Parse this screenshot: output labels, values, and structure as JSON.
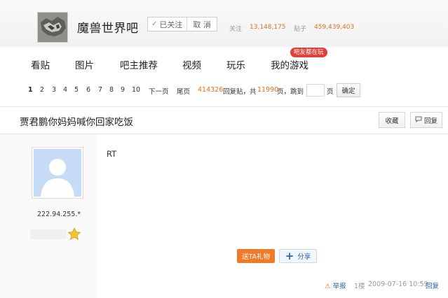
{
  "forum": {
    "title": "魔兽世界吧",
    "followed_label": "已关注",
    "unfollow_label": "取 消",
    "follow_count_label": "关注",
    "follow_count": "13,148,175",
    "post_count_label": "贴子",
    "post_count": "459,439,403"
  },
  "nav": {
    "items": [
      {
        "label": "看贴"
      },
      {
        "label": "图片"
      },
      {
        "label": "吧主推荐"
      },
      {
        "label": "视频"
      },
      {
        "label": "玩乐"
      },
      {
        "label": "我的游戏"
      }
    ],
    "bubble": "吧友都在玩"
  },
  "pager": {
    "pages": [
      "1",
      "2",
      "3",
      "4",
      "5",
      "6",
      "7",
      "8",
      "9",
      "10"
    ],
    "current": "1",
    "next": "下一页",
    "last": "尾页",
    "reply_total": "414326",
    "reply_label": "回复贴，共",
    "page_total": "11990",
    "page_label": "页，",
    "jump_label": "跳到",
    "jump_value": "",
    "page_unit": "页",
    "confirm": "确定"
  },
  "thread": {
    "title": "贾君鹏你妈妈喊你回家吃饭",
    "favorite": "收藏",
    "reply": "回复"
  },
  "post": {
    "author_ip": "222.94.255.*",
    "content": "RT",
    "gift": "送TA礼物",
    "share": "分享",
    "report": "举报",
    "floor": "1楼",
    "time": "2009-07-16 10:59",
    "reply": "回复"
  },
  "colors": {
    "accent_orange": "#e0701e",
    "link_blue": "#2d64b3",
    "gift_orange": "#ef7a2a",
    "bubble_red": "#e2413a"
  }
}
